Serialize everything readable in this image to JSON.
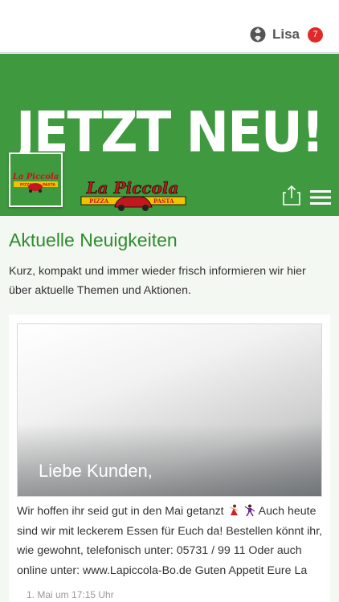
{
  "topbar": {
    "user_name": "Lisa",
    "notification_count": "7",
    "badge_color": "#e02a2a"
  },
  "hero": {
    "title": "JETZT NEU!",
    "background_color": "#3f9a3f",
    "logo_small": {
      "name": "La Piccola",
      "left_tag": "PIZZA",
      "right_tag": "PASTA"
    },
    "logo_brand": {
      "name": "La Piccola",
      "left_tag": "PIZZA",
      "right_tag": "PASTA"
    },
    "share_icon": "share-icon",
    "menu_icon": "hamburger-menu-icon"
  },
  "news": {
    "title": "Aktuelle Neuigkeiten",
    "intro": "Kurz, kompakt und immer wieder frisch informieren wir hier über aktuelle Themen und Aktionen.",
    "accent_color": "#2e8b2e"
  },
  "post": {
    "headline": "Liebe Kunden,",
    "text_before_emoji": "Wir hoffen ihr seid gut in den Mai getanzt ",
    "emoji_icons": [
      "dancing-woman-emoji",
      "dancing-man-emoji"
    ],
    "text_after_emoji": " Auch heute sind wir mit leckerem Essen für Euch da! Bestellen könnt ihr, wie gewohnt, telefonisch unter: 05731 / 99 11 Oder auch online unter: www.Lapiccola-Bo.de Guten Appetit Eure La",
    "date": "1. Mai um 17:15 Uhr"
  }
}
